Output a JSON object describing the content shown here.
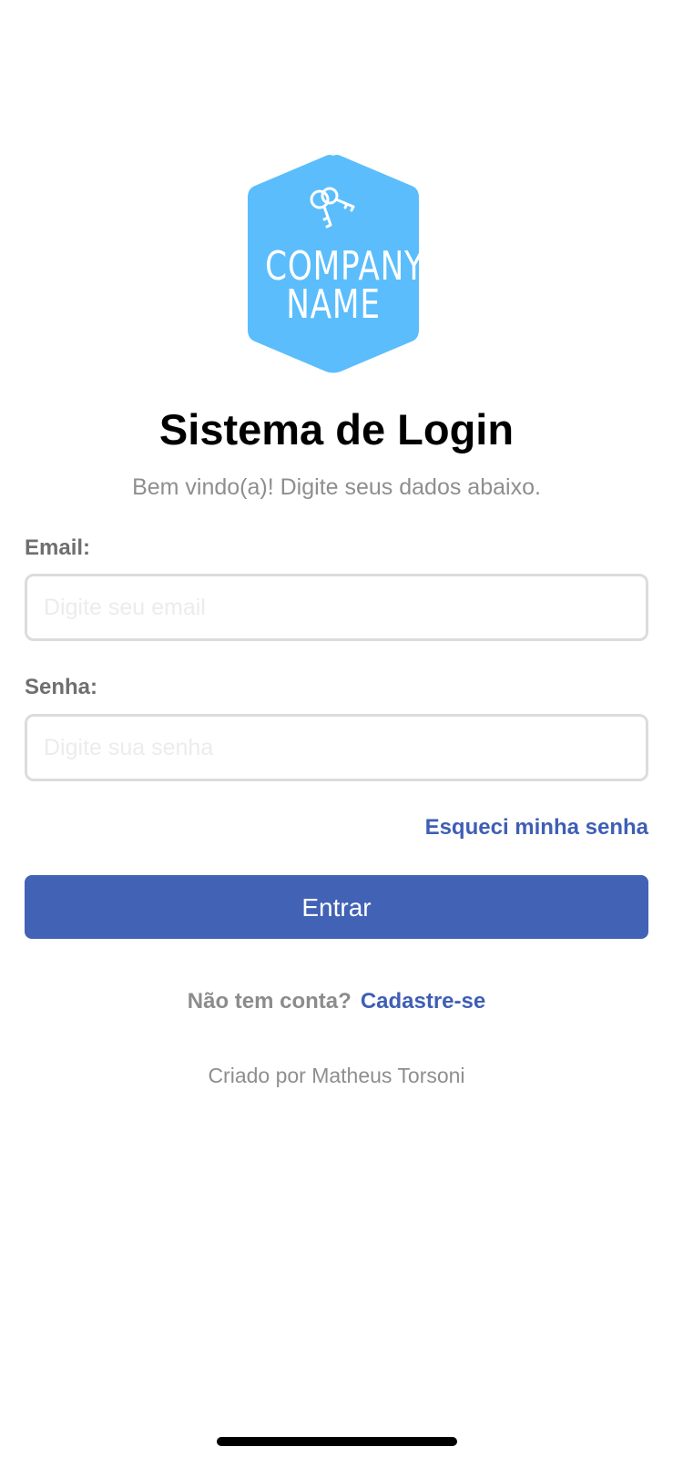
{
  "logo": {
    "line1": "COMPANY",
    "line2": "NAME",
    "color": "#5bbdfc",
    "icon": "keys-icon"
  },
  "header": {
    "title": "Sistema de Login",
    "subtitle": "Bem vindo(a)! Digite seus dados abaixo."
  },
  "form": {
    "email_label": "Email:",
    "email_placeholder": "Digite seu email",
    "email_value": "",
    "password_label": "Senha:",
    "password_placeholder": "Digite sua senha",
    "password_value": "",
    "forgot_link": "Esqueci minha senha",
    "submit_label": "Entrar"
  },
  "signup": {
    "prompt": "Não tem conta?",
    "link": "Cadastre-se"
  },
  "footer": {
    "credits": "Criado por Matheus Torsoni"
  },
  "colors": {
    "accent": "#4262b6",
    "link": "#3f5fb5",
    "muted_text": "#8e8e8e",
    "border": "#dcdcdc"
  }
}
